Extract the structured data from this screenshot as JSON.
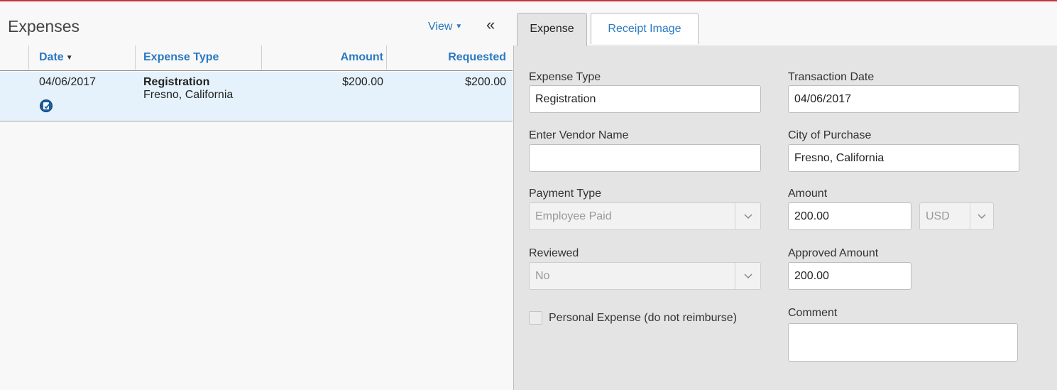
{
  "left_panel": {
    "title": "Expenses",
    "view_menu": "View",
    "collapse": "«",
    "columns": {
      "date": "Date",
      "expense_type": "Expense Type",
      "amount": "Amount",
      "requested": "Requested"
    },
    "rows": [
      {
        "date": "04/06/2017",
        "expense_type": "Registration",
        "location": "Fresno, California",
        "amount": "$200.00",
        "requested": "$200.00"
      }
    ]
  },
  "right_panel": {
    "tabs": {
      "expense": "Expense",
      "receipt_image": "Receipt Image"
    },
    "form": {
      "expense_type": {
        "label": "Expense Type",
        "value": "Registration"
      },
      "transaction_date": {
        "label": "Transaction Date",
        "value": "04/06/2017"
      },
      "vendor_name": {
        "label": "Enter Vendor Name",
        "value": ""
      },
      "city_of_purchase": {
        "label": "City of Purchase",
        "value": "Fresno, California"
      },
      "payment_type": {
        "label": "Payment Type",
        "value": "Employee Paid"
      },
      "amount": {
        "label": "Amount",
        "value": "200.00",
        "currency": "USD"
      },
      "reviewed": {
        "label": "Reviewed",
        "value": "No"
      },
      "approved_amount": {
        "label": "Approved Amount",
        "value": "200.00"
      },
      "personal_expense": {
        "label": "Personal Expense (do not reimburse)",
        "checked": false
      },
      "comment": {
        "label": "Comment",
        "value": ""
      }
    }
  },
  "colors": {
    "accent": "#2b79c2",
    "top_rule": "#c8323c",
    "row_selected": "#e5f2fb",
    "form_bg": "#e4e4e4"
  }
}
